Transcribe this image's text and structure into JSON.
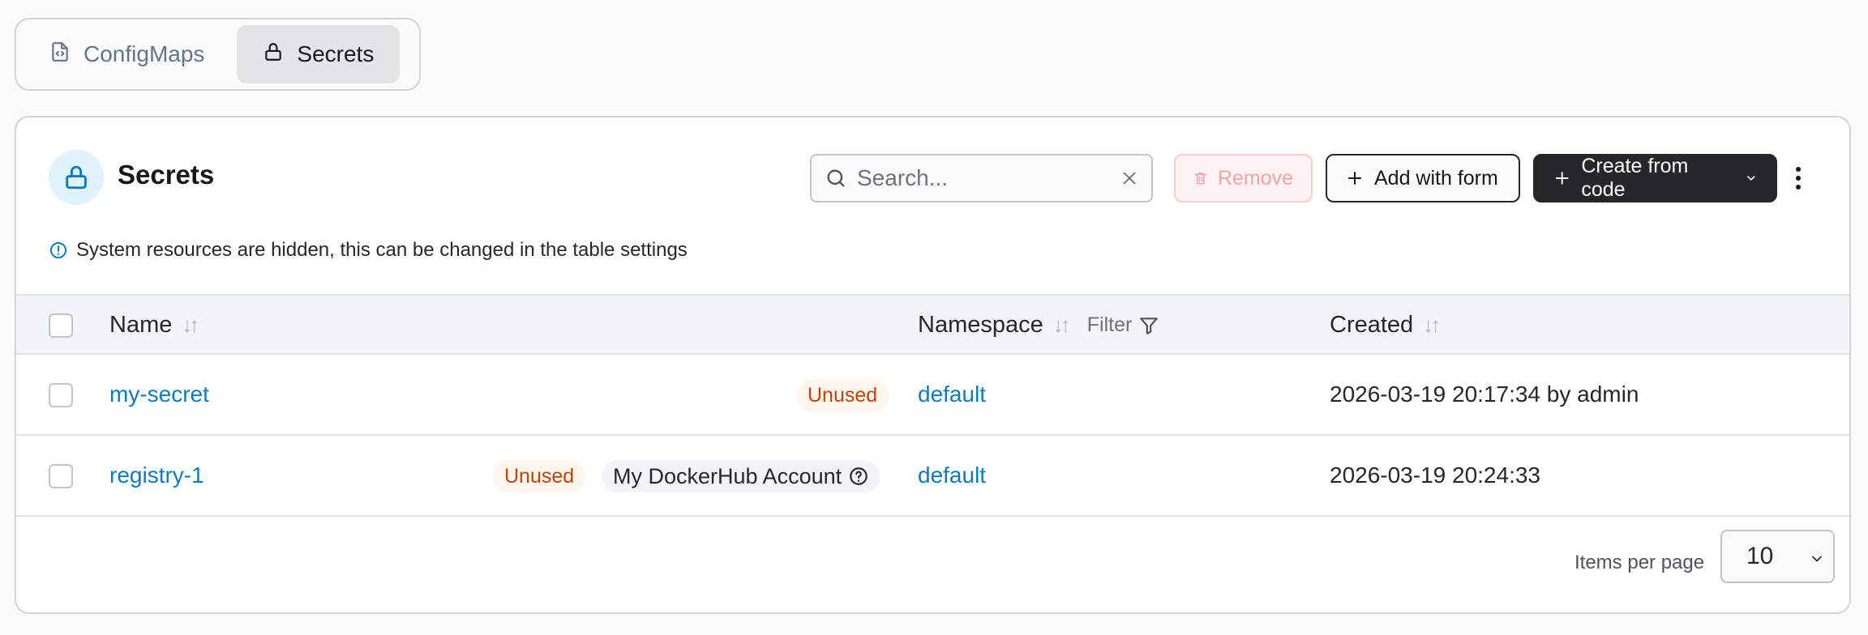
{
  "tabs": [
    {
      "label": "ConfigMaps",
      "icon": "file-code-icon",
      "active": false
    },
    {
      "label": "Secrets",
      "icon": "lock-icon",
      "active": true
    }
  ],
  "header": {
    "title": "Secrets",
    "title_icon": "lock-icon",
    "search_placeholder": "Search...",
    "remove_label": "Remove",
    "add_label": "Add with form",
    "create_label": "Create from code"
  },
  "info": {
    "text": "System resources are hidden, this can be changed in the table settings"
  },
  "table": {
    "columns": {
      "name": "Name",
      "namespace": "Namespace",
      "filter": "Filter",
      "created": "Created"
    },
    "rows": [
      {
        "name": "my-secret",
        "status": "Unused",
        "description": "",
        "namespace": "default",
        "created": "2026-03-19 20:17:34 by admin"
      },
      {
        "name": "registry-1",
        "status": "Unused",
        "description": "My DockerHub Account",
        "namespace": "default",
        "created": "2026-03-19 20:24:33"
      }
    ]
  },
  "pagination": {
    "items_per_page_label": "Items per page",
    "items_per_page_value": "10"
  },
  "colors": {
    "accent": "#0b7cc1",
    "unused_badge": "#c2410c",
    "primary_button": "#27272a",
    "remove_button_text": "#f0a5a5"
  }
}
